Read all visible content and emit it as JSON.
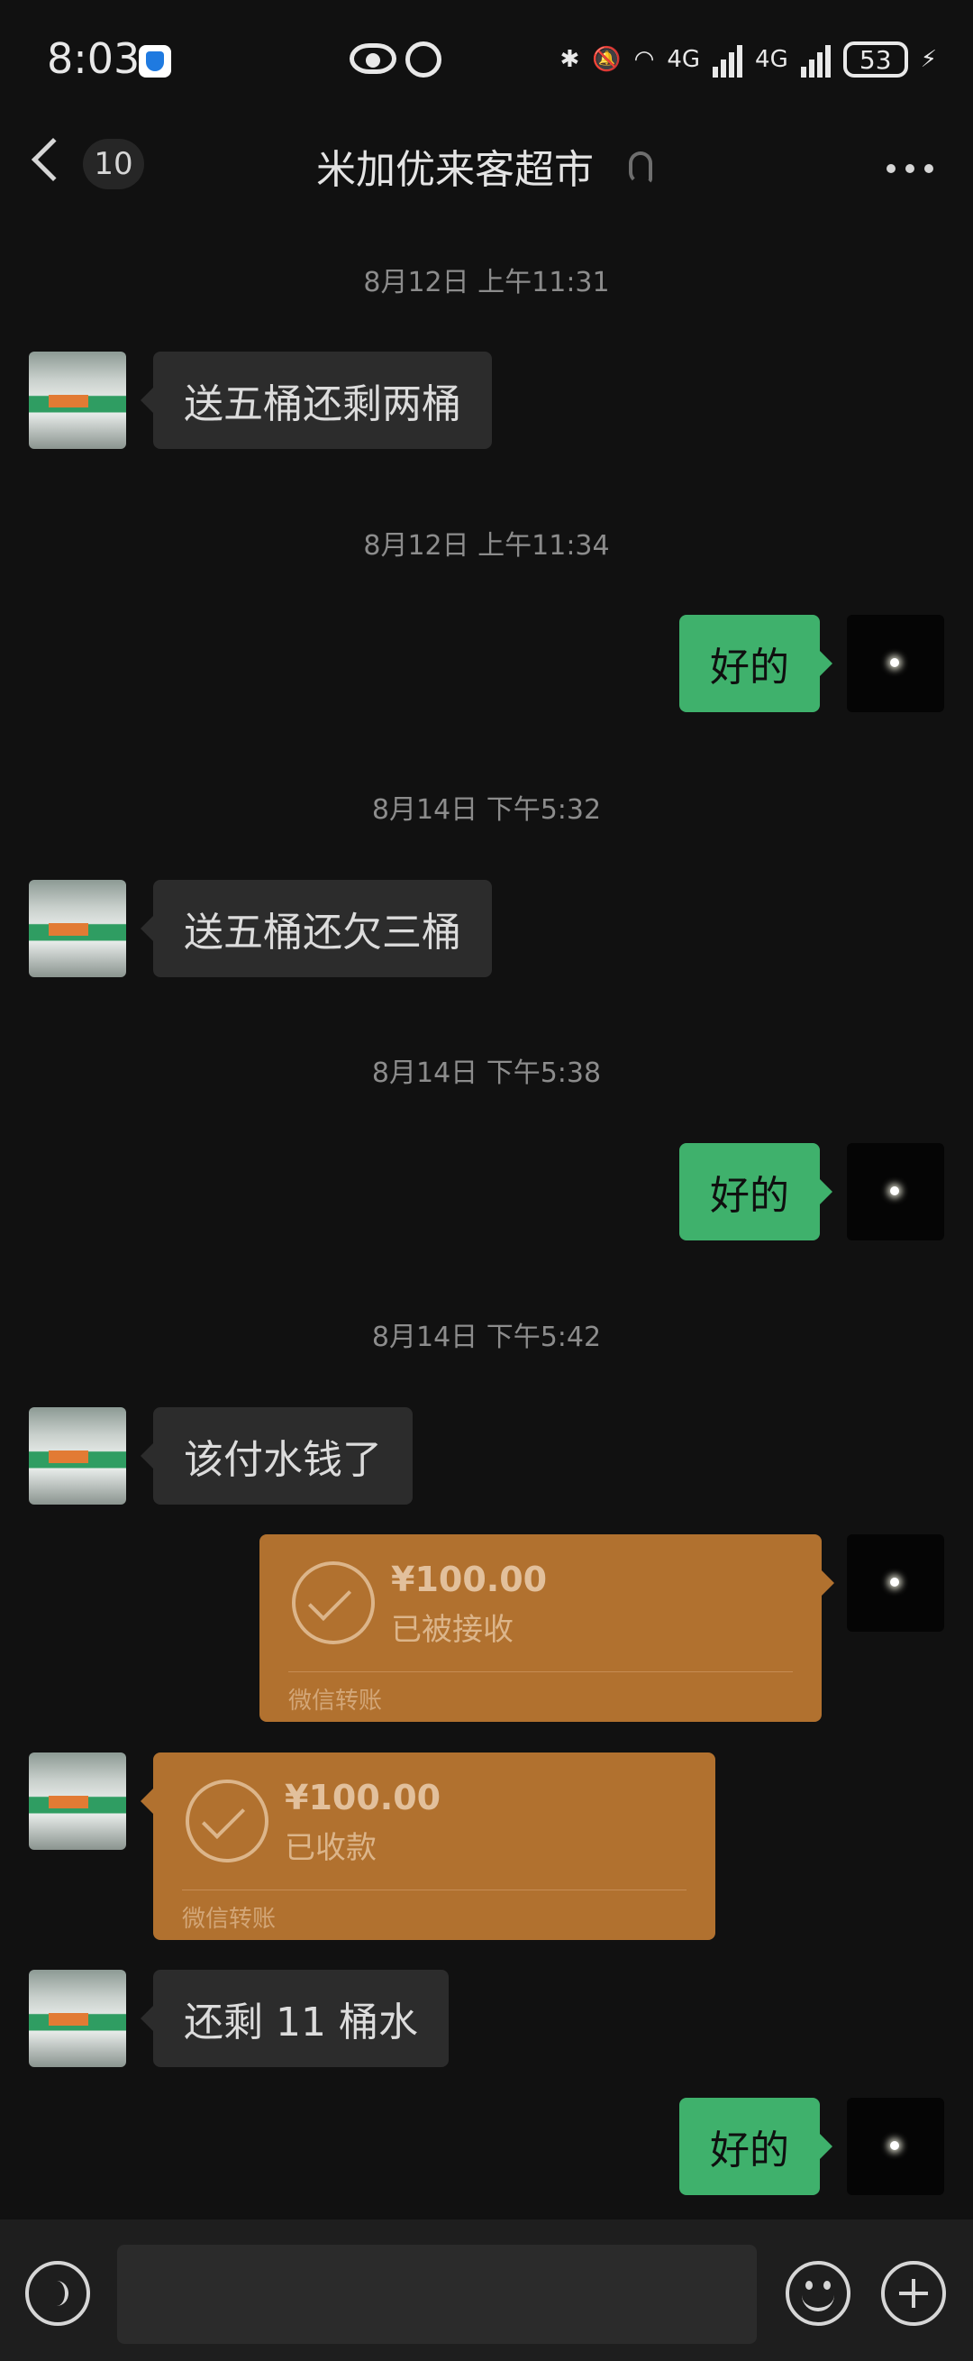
{
  "status_bar": {
    "time": "8:03",
    "network_1": "4G",
    "network_2": "4G",
    "battery": "53",
    "icons": [
      "shield-icon",
      "eye-icon",
      "alarm-icon",
      "bluetooth-icon",
      "mute-icon",
      "wifi-icon",
      "signal-icon",
      "charging-icon"
    ]
  },
  "header": {
    "unread_count": "10",
    "title": "米加优来客超市",
    "icons": [
      "back-icon",
      "ear-icon",
      "more-icon"
    ]
  },
  "messages": {
    "ts1": "8月12日 上午11:31",
    "m1": "送五桶还剩两桶",
    "ts2": "8月12日 上午11:34",
    "m2": "好的",
    "ts3": "8月14日 下午5:32",
    "m3": "送五桶还欠三桶",
    "ts4": "8月14日 下午5:38",
    "m4": "好的",
    "ts5": "8月14日 下午5:42",
    "m5": "该付水钱了",
    "transfer_out": {
      "amount": "¥100.00",
      "status": "已被接收",
      "label": "微信转账"
    },
    "transfer_in": {
      "amount": "¥100.00",
      "status": "已收款",
      "label": "微信转账"
    },
    "m6": "还剩 11 桶水",
    "m7": "好的"
  },
  "colors": {
    "background": "#111111",
    "incoming_bubble": "#2c2c2c",
    "outgoing_bubble": "#3fb16c",
    "transfer_card": "#b1712f"
  },
  "input_bar": {
    "icons": [
      "voice-icon",
      "emoji-icon",
      "plus-icon"
    ]
  }
}
